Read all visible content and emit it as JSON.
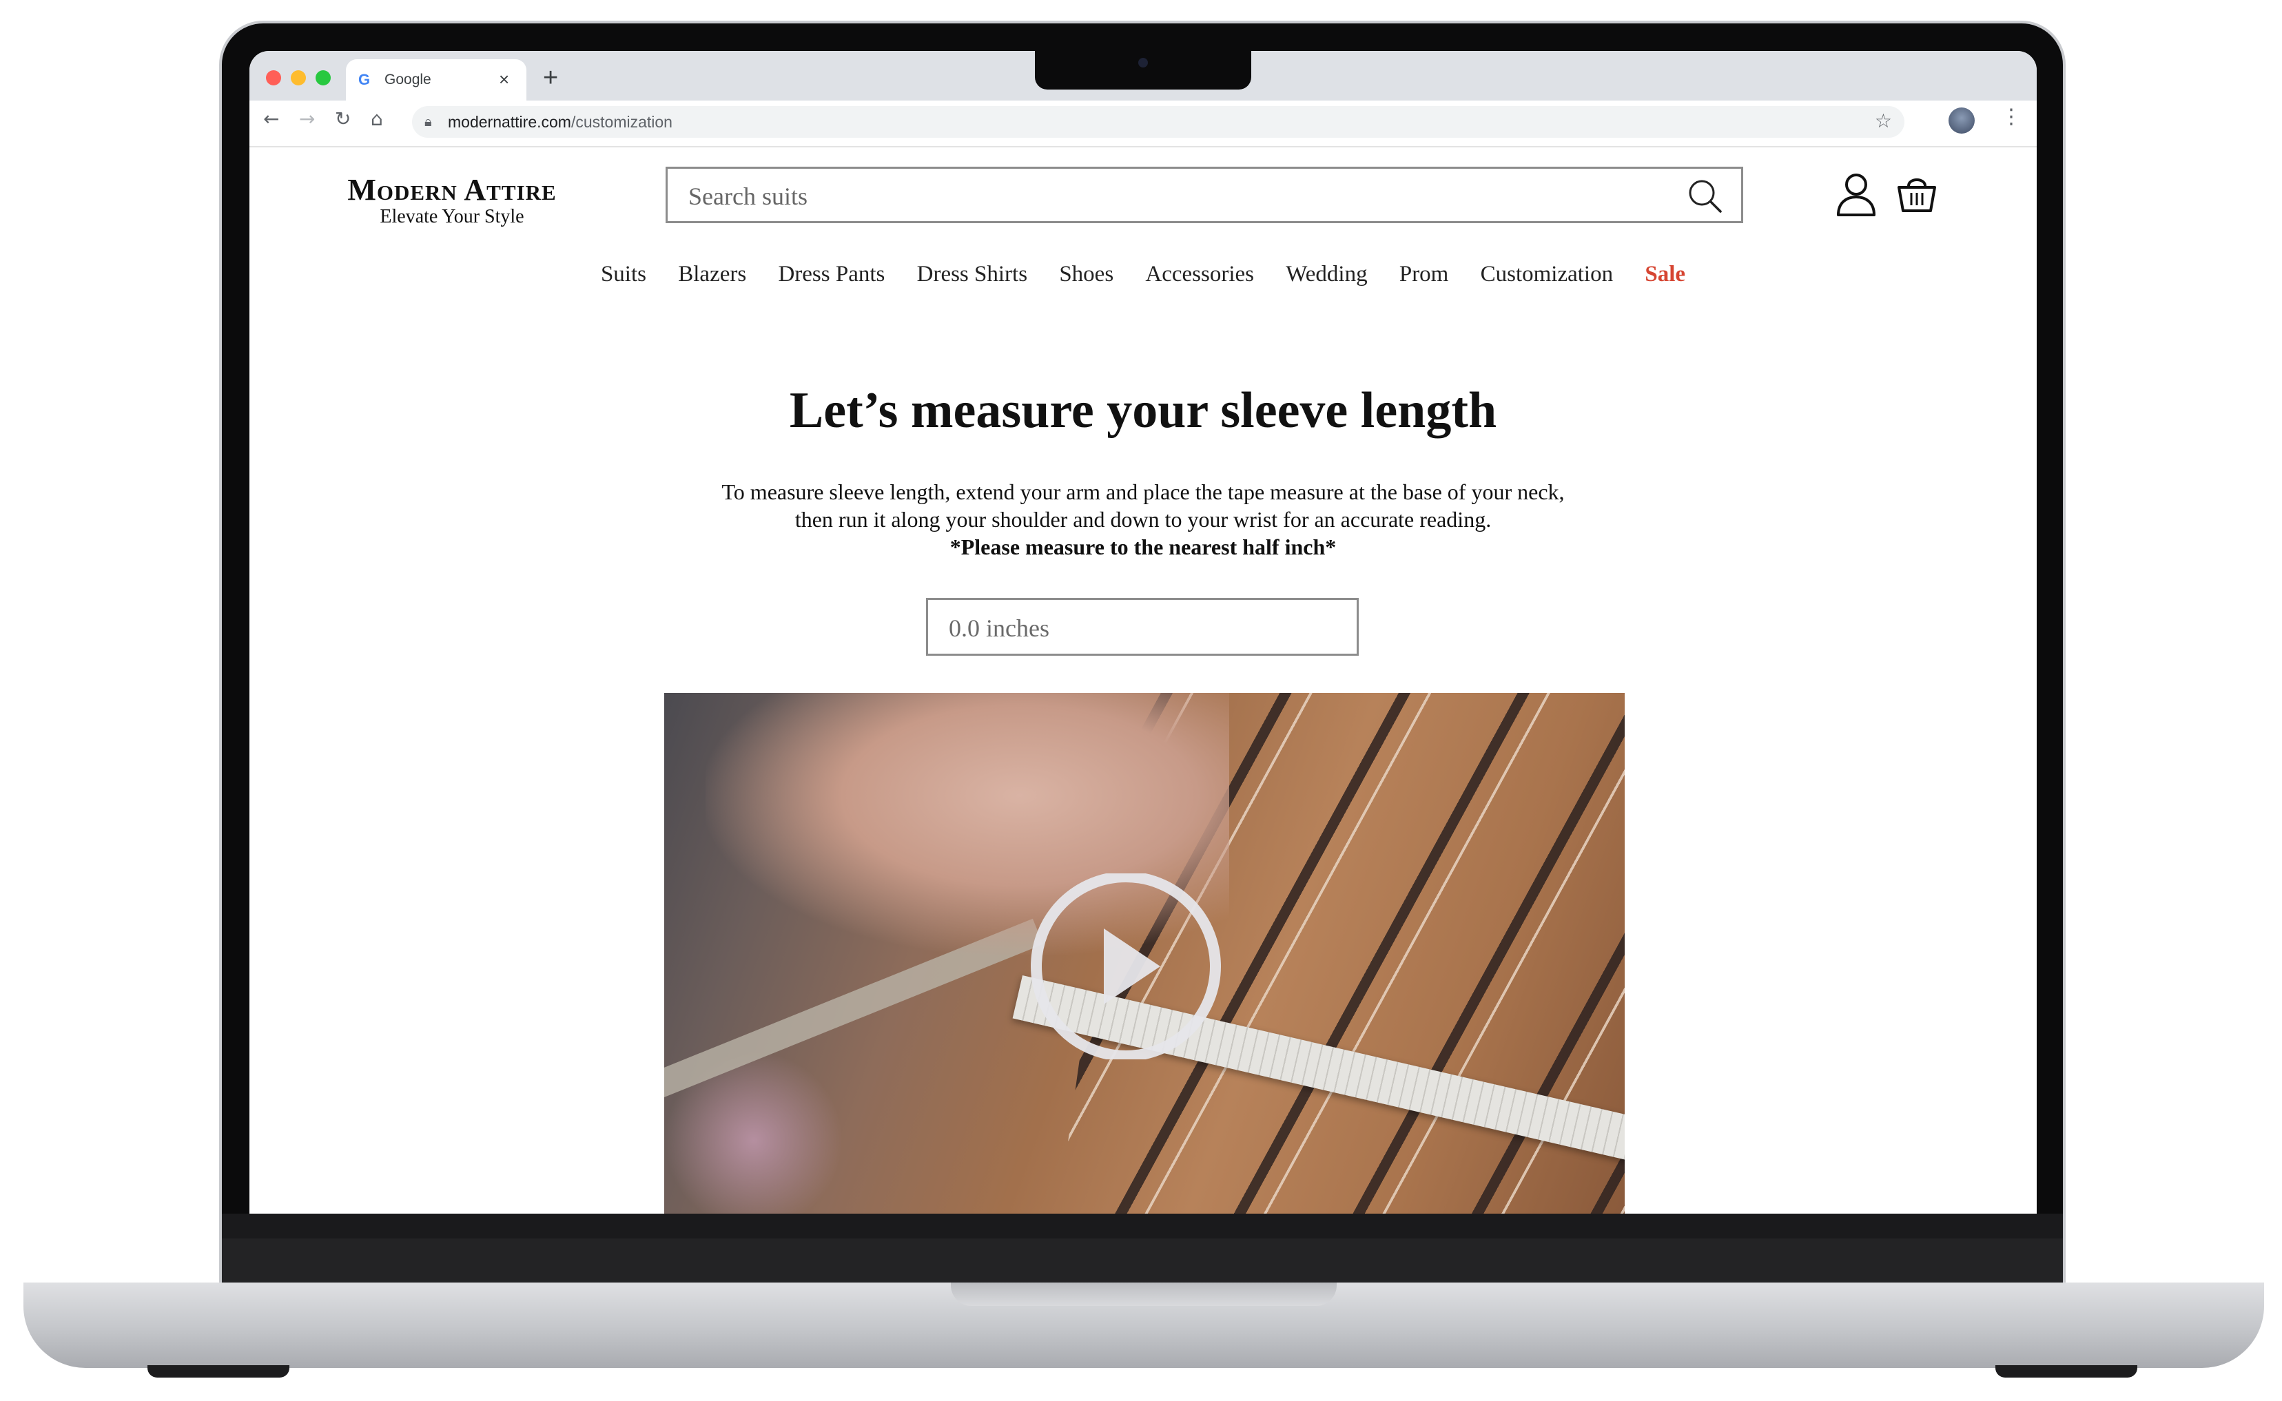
{
  "browser": {
    "tab_title": "Google",
    "tab_close": "×",
    "new_tab": "+",
    "url_domain": "modernattire.com",
    "url_path": "/customization"
  },
  "site": {
    "brand": "Modern Attire",
    "tagline": "Elevate Your Style",
    "search_placeholder": "Search suits",
    "nav": [
      "Suits",
      "Blazers",
      "Dress Pants",
      "Dress Shirts",
      "Shoes",
      "Accessories",
      "Wedding",
      "Prom",
      "Customization",
      "Sale"
    ],
    "sale_color": "#d64532"
  },
  "main": {
    "heading": "Let’s measure your sleeve length",
    "instructions_line1": "To measure sleeve length, extend your arm and place the tape measure at the base of your neck,",
    "instructions_line2": "then run it along your shoulder and down to your wrist for an accurate reading.",
    "note": "*Please measure to the nearest half inch*",
    "measurement_placeholder": "0.0 inches",
    "video_icon": "play-icon"
  }
}
